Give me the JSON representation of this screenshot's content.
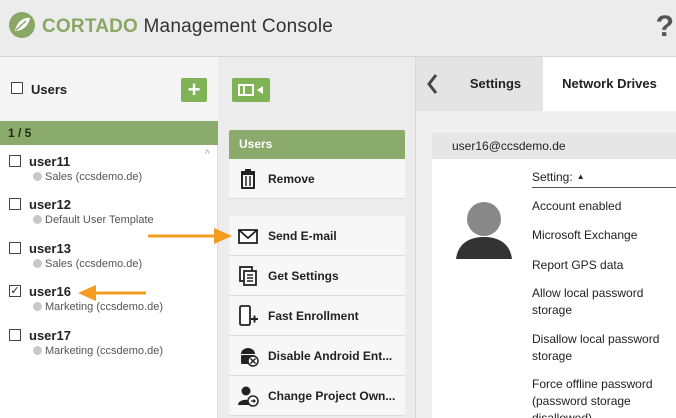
{
  "header": {
    "brand_strong": "CORTADO",
    "brand_rest": " Management Console",
    "help_glyph": "?",
    "accent_color": "#8aa764"
  },
  "left_panel": {
    "title": "Users",
    "add_glyph": "+",
    "pager": "1 / 5",
    "users": [
      {
        "name": "user11",
        "group": "Sales (ccsdemo.de)",
        "checked": false
      },
      {
        "name": "user12",
        "group": "Default User Template",
        "checked": false
      },
      {
        "name": "user13",
        "group": "Sales (ccsdemo.de)",
        "checked": false
      },
      {
        "name": "user16",
        "group": "Marketing (ccsdemo.de)",
        "checked": true
      },
      {
        "name": "user17",
        "group": "Marketing (ccsdemo.de)",
        "checked": false
      }
    ]
  },
  "menu": {
    "header": "Users",
    "items": [
      {
        "label": "Remove",
        "icon": "trash-icon"
      },
      {
        "label": "Send E-mail",
        "icon": "mail-icon"
      },
      {
        "label": "Get Settings",
        "icon": "settings-copy-icon"
      },
      {
        "label": "Fast Enrollment",
        "icon": "phone-plus-icon"
      },
      {
        "label": "Disable Android Ent...",
        "icon": "android-disable-icon"
      },
      {
        "label": "Change Project Own...",
        "icon": "user-change-icon"
      }
    ]
  },
  "right_panel": {
    "tabs": [
      "Settings",
      "Network Drives"
    ],
    "active_tab": "Settings",
    "email": "user16@ccsdemo.de",
    "setting_header": "Setting:",
    "settings": [
      "Account enabled",
      "Microsoft Exchange",
      "Report GPS data",
      "Allow local password storage",
      "Disallow local password storage",
      "Force offline password (password storage disallowed)"
    ]
  },
  "colors": {
    "green": "#7fb356",
    "green_bar": "#8aab6b",
    "arrow": "#f39c1f"
  }
}
